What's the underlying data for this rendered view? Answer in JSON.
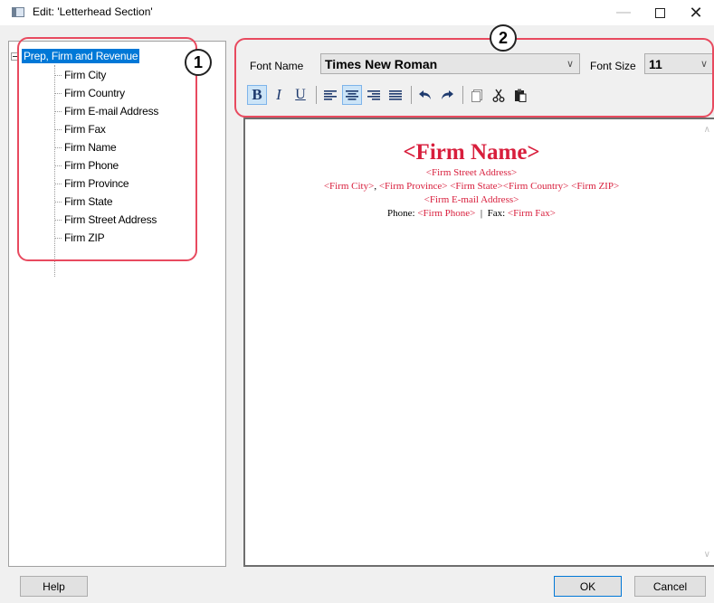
{
  "window": {
    "title": "Edit: 'Letterhead Section'",
    "close_glyph": "✕",
    "minimize_glyph": "—"
  },
  "tree": {
    "root_label": "Prep, Firm and Revenue",
    "items": [
      "Firm City",
      "Firm Country",
      "Firm E-mail Address",
      "Firm Fax",
      "Firm Name",
      "Firm Phone",
      "Firm Province",
      "Firm State",
      "Firm Street Address",
      "Firm ZIP"
    ]
  },
  "callouts": {
    "tree": "1",
    "toolbar": "2"
  },
  "toolbar": {
    "font_name_label": "Font Name",
    "font_name_value": "Times New Roman",
    "font_size_label": "Font Size",
    "font_size_value": "11",
    "dropdown_glyph": "∨",
    "buttons": {
      "bold": "B",
      "italic": "I",
      "underline": "U",
      "align_left": "align-left-icon",
      "align_center": "align-center-icon",
      "align_right": "align-right-icon",
      "justify": "justify-icon",
      "undo": "undo-icon",
      "redo": "redo-icon",
      "copy": "copy-icon",
      "cut": "cut-icon",
      "paste": "paste-icon"
    }
  },
  "document": {
    "firm_name": "<Firm Name>",
    "street": "<Firm Street Address>",
    "city_line": {
      "city": "<Firm City>",
      "sep": ",",
      "rest": " <Firm Province> <Firm State><Firm Country> <Firm ZIP>"
    },
    "email": "<Firm E-mail Address>",
    "contact": {
      "phone_label": "Phone:",
      "phone_value": "<Firm Phone>",
      "divider": "|",
      "fax_label": "Fax:",
      "fax_value": "<Firm Fax>"
    },
    "color": "#d81e3c"
  },
  "buttons": {
    "help": "Help",
    "ok": "OK",
    "cancel": "Cancel"
  },
  "colors": {
    "selection": "#0078d7",
    "callout": "#e84a5f",
    "active_button": "#cce4f7"
  }
}
